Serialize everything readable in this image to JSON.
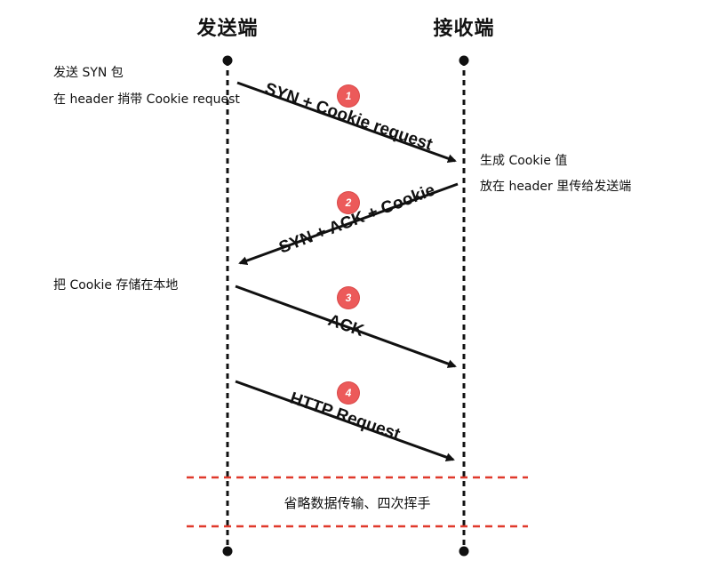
{
  "parties": {
    "sender": "发送端",
    "receiver": "接收端"
  },
  "notes": {
    "sender_1_line1": "发送 SYN 包",
    "sender_1_line2": "在 header 捎带 Cookie request",
    "receiver_1_line1": "生成 Cookie 值",
    "receiver_1_line2": "放在 header 里传给发送端",
    "sender_2": "把 Cookie 存储在本地"
  },
  "messages": [
    {
      "step": "1",
      "label": "SYN + Cookie request",
      "from": "sender",
      "to": "receiver"
    },
    {
      "step": "2",
      "label": "SYN + ACK + Cookie",
      "from": "receiver",
      "to": "sender"
    },
    {
      "step": "3",
      "label": "ACK",
      "from": "sender",
      "to": "receiver"
    },
    {
      "step": "4",
      "label": "HTTP Request",
      "from": "sender",
      "to": "receiver"
    }
  ],
  "omitted_note": "省略数据传输、四次挥手",
  "colors": {
    "line": "#111111",
    "badge": "#ec5a5a",
    "separator": "#e0392b"
  }
}
